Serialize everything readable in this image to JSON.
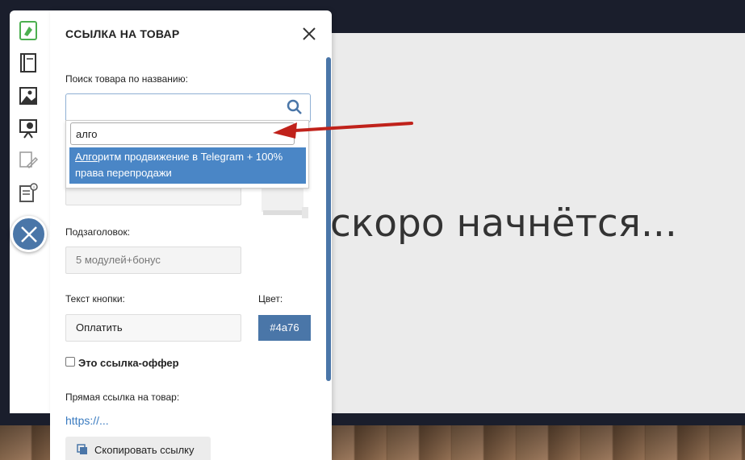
{
  "background": {
    "screen_text": "скоро начнётся..."
  },
  "toolbar": {
    "icons": [
      "product-link-icon",
      "notebook-icon",
      "image-icon",
      "presentation-icon",
      "tools-icon",
      "info-doc-icon"
    ],
    "close_icon": "close-icon"
  },
  "panel": {
    "title": "ССЫЛКА НА ТОВАР",
    "search_label": "Поиск товара по названию:",
    "search_query": "алго",
    "result_highlight": "Алго",
    "result_rest": "ритм продвижение в Telegram + 100% права перепродажи",
    "subtitle_label": "Подзаголовок:",
    "subtitle_placeholder": "5 модулей+бонус",
    "button_text_label": "Текст кнопки:",
    "button_text_value": "Оплатить",
    "color_label": "Цвет:",
    "color_value": "#4a76",
    "offer_checkbox_label": "Это ссылка-оффер",
    "direct_link_label": "Прямая ссылка на товар:",
    "direct_link": "https://...",
    "copy_button": "Скопировать ссылку"
  },
  "colors": {
    "accent": "#4a76a8",
    "highlight": "#4a86c6",
    "arrow": "#c0221b"
  }
}
